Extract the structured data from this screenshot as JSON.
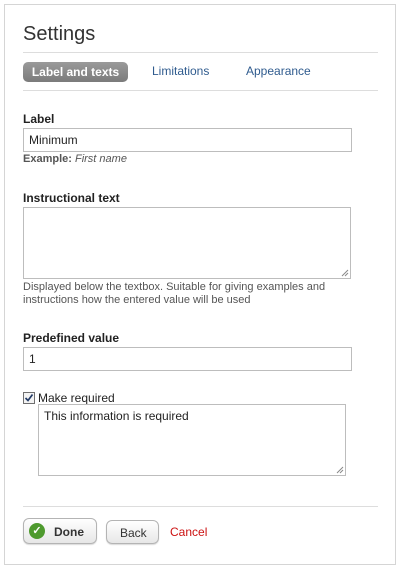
{
  "header": {
    "title": "Settings"
  },
  "tabs": [
    {
      "label": "Label and texts",
      "active": true
    },
    {
      "label": "Limitations",
      "active": false
    },
    {
      "label": "Appearance",
      "active": false
    }
  ],
  "fields": {
    "label": {
      "title": "Label",
      "value": "Minimum",
      "example_prefix": "Example:",
      "example_value": "First name"
    },
    "instructional": {
      "title": "Instructional text",
      "value": "",
      "hint_line1": "Displayed below the textbox. Suitable for giving examples and",
      "hint_line2": "instructions how the entered value will be used"
    },
    "predefined": {
      "title": "Predefined value",
      "value": "1"
    },
    "required": {
      "label": "Make required",
      "checked": true,
      "message": "This information is required"
    }
  },
  "footer": {
    "done_label": "Done",
    "back_label": "Back",
    "cancel_label": "Cancel"
  },
  "colors": {
    "tab_link": "#2f5b8e",
    "cancel": "#cc1111",
    "done_icon": "#4e9a2e"
  },
  "icons": {
    "done": "checkmark-circle-icon",
    "check": "checkmark-icon"
  }
}
